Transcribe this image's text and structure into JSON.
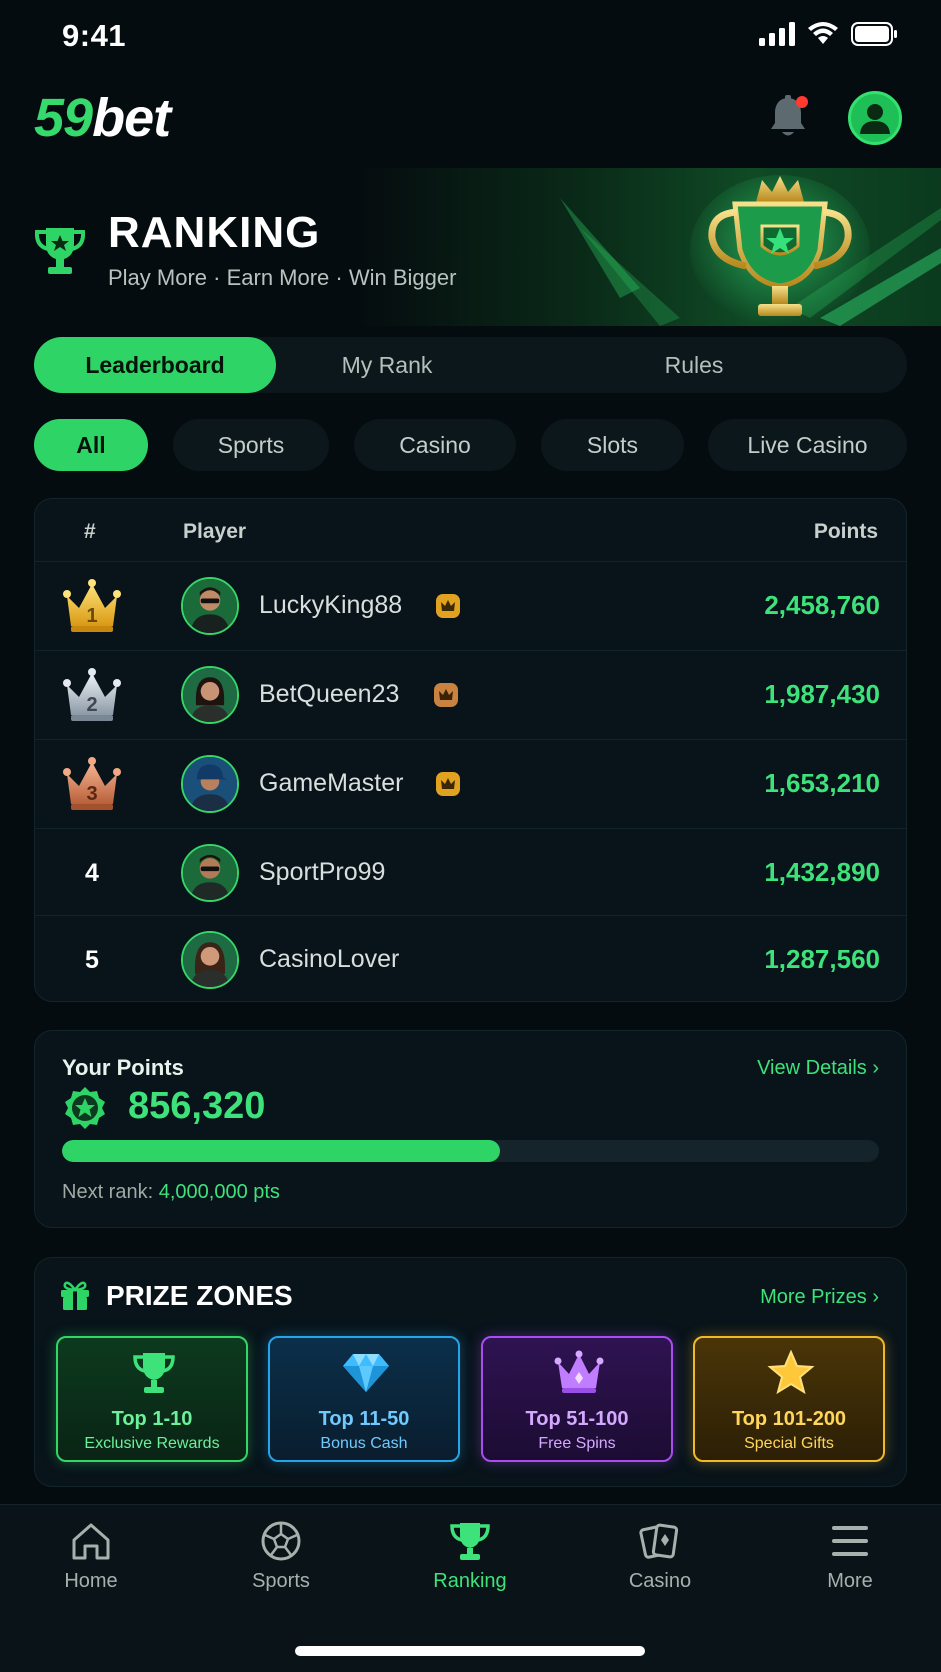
{
  "status_bar": {
    "time": "9:41"
  },
  "header": {
    "logo_part1": "59",
    "logo_part2": "bet",
    "notification_dot_color": "#ff3b30"
  },
  "hero": {
    "title": "RANKING",
    "subtitle": "Play More · Earn More · Win Bigger"
  },
  "main_tabs": [
    {
      "label": "Leaderboard",
      "active": true
    },
    {
      "label": "My Rank",
      "active": false
    },
    {
      "label": "Rules",
      "active": false
    }
  ],
  "filters": [
    {
      "label": "All",
      "active": true
    },
    {
      "label": "Sports",
      "active": false
    },
    {
      "label": "Casino",
      "active": false
    },
    {
      "label": "Slots",
      "active": false
    },
    {
      "label": "Live Casino",
      "active": false
    }
  ],
  "leaderboard": {
    "columns": {
      "rank": "#",
      "player": "Player",
      "points": "Points"
    },
    "rows": [
      {
        "rank": "1",
        "medal": "gold-crown",
        "name": "LuckyKing88",
        "badge": "vip-crown-badge",
        "points": "2,458,760"
      },
      {
        "rank": "2",
        "medal": "silver-crown",
        "name": "BetQueen23",
        "badge": "vip-crown-badge",
        "points": "1,987,430"
      },
      {
        "rank": "3",
        "medal": "bronze-crown",
        "name": "GameMaster",
        "badge": "vip-crown-badge",
        "points": "1,653,210"
      },
      {
        "rank": "4",
        "medal": null,
        "name": "SportPro99",
        "badge": null,
        "points": "1,432,890"
      },
      {
        "rank": "5",
        "medal": null,
        "name": "CasinoLover",
        "badge": null,
        "points": "1,287,560"
      }
    ]
  },
  "your_points": {
    "label": "Your Points",
    "link": "View Details",
    "value": "856,320",
    "progress_fraction": 0.536,
    "next_rank_label": "Next rank:",
    "next_rank_value": "4,000,000 pts"
  },
  "prize_zones": {
    "title": "PRIZE ZONES",
    "link": "More Prizes",
    "zones": [
      {
        "title": "Top 1-10",
        "subtitle": "Exclusive Rewards",
        "icon": "trophy-icon",
        "color": "#33d765"
      },
      {
        "title": "Top 11-50",
        "subtitle": "Bonus Cash",
        "icon": "diamond-icon",
        "color": "#26a4e8"
      },
      {
        "title": "Top 51-100",
        "subtitle": "Free Spins",
        "icon": "crown-icon",
        "color": "#a84ef0"
      },
      {
        "title": "Top 101-200",
        "subtitle": "Special Gifts",
        "icon": "star-icon",
        "color": "#f2b925"
      }
    ]
  },
  "bottom_nav": [
    {
      "label": "Home",
      "icon": "home-icon",
      "active": false
    },
    {
      "label": "Sports",
      "icon": "soccer-ball-icon",
      "active": false
    },
    {
      "label": "Ranking",
      "icon": "trophy-icon",
      "active": true
    },
    {
      "label": "Casino",
      "icon": "cards-icon",
      "active": false
    },
    {
      "label": "More",
      "icon": "menu-icon",
      "active": false
    }
  ],
  "colors": {
    "accent": "#2fd466",
    "background": "#050c0f"
  }
}
